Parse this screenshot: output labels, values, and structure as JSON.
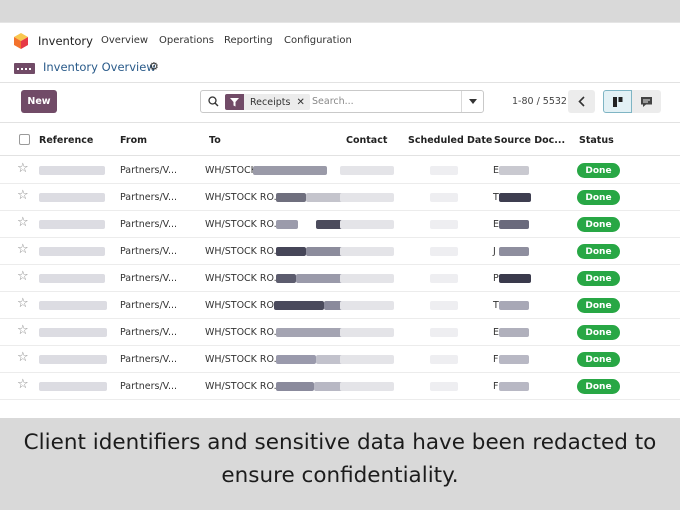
{
  "app": {
    "name": "Inventory",
    "menu": [
      "Overview",
      "Operations",
      "Reporting",
      "Configuration"
    ]
  },
  "breadcrumb": {
    "title": "Inventory Overview"
  },
  "toolbar": {
    "new_label": "New",
    "search": {
      "facet": "Receipts",
      "placeholder": "Search..."
    },
    "pager": "1-80 / 5532"
  },
  "table": {
    "headers": [
      "Reference",
      "From",
      "To",
      "Contact",
      "Scheduled Date",
      "Source Doc...",
      "Status"
    ],
    "rows": [
      {
        "reference": "",
        "from": "Partners/V...",
        "to": "WH/STOCK",
        "contact": "",
        "source": "E",
        "status": "Done"
      },
      {
        "reference": "",
        "from": "Partners/V...",
        "to": "WH/STOCK RO...",
        "contact": "",
        "source": "T",
        "status": "Done"
      },
      {
        "reference": "",
        "from": "Partners/V...",
        "to": "WH/STOCK RO...",
        "contact": "",
        "source": "E",
        "status": "Done"
      },
      {
        "reference": "",
        "from": "Partners/V...",
        "to": "WH/STOCK RO...",
        "contact": "",
        "source": "J",
        "status": "Done"
      },
      {
        "reference": "",
        "from": "Partners/V...",
        "to": "WH/STOCK RO...",
        "contact": "",
        "source": "P",
        "status": "Done"
      },
      {
        "reference": "",
        "from": "Partners/V...",
        "to": "WH/STOCK RO...",
        "contact": "",
        "source": "T",
        "status": "Done"
      },
      {
        "reference": "",
        "from": "Partners/V...",
        "to": "WH/STOCK RO...",
        "contact": "",
        "source": "E",
        "status": "Done"
      },
      {
        "reference": "",
        "from": "Partners/V...",
        "to": "WH/STOCK RO...",
        "contact": "",
        "source": "F",
        "status": "Done"
      },
      {
        "reference": "",
        "from": "Partners/V...",
        "to": "WH/STOCK RO...",
        "contact": "",
        "source": "F",
        "status": "Done"
      }
    ]
  },
  "caption": {
    "line1": "Client identifiers and sensitive data have been redacted to",
    "line2": "ensure confidentiality."
  },
  "colors": {
    "brand": "#714b67",
    "status_done": "#28a745",
    "link": "#2a5b8a"
  },
  "icons": [
    "inventory-logo-icon",
    "gear-icon",
    "search-icon",
    "filter-icon",
    "close-icon",
    "caret-down-icon",
    "chevron-left-icon",
    "kanban-icon",
    "chat-icon",
    "star-icon"
  ]
}
